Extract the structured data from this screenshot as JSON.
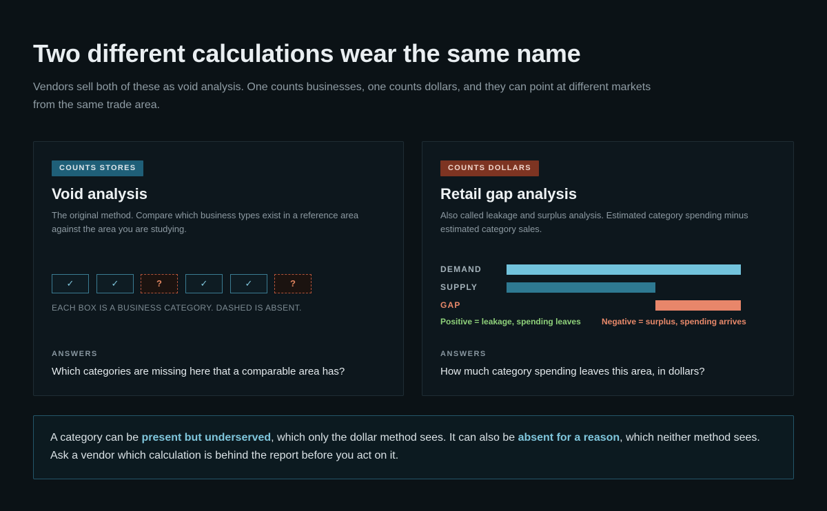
{
  "header": {
    "title": "Two different calculations wear the same name",
    "subtitle": "Vendors sell both of these as void analysis. One counts businesses, one counts dollars, and they can point at different markets from the same trade area."
  },
  "cards": {
    "void": {
      "tag": "COUNTS STORES",
      "title": "Void analysis",
      "description": "The original method. Compare which business types exist in a reference area against the area you are studying.",
      "boxes": [
        {
          "state": "present",
          "glyph": "✓"
        },
        {
          "state": "present",
          "glyph": "✓"
        },
        {
          "state": "absent",
          "glyph": "?"
        },
        {
          "state": "present",
          "glyph": "✓"
        },
        {
          "state": "present",
          "glyph": "✓"
        },
        {
          "state": "absent",
          "glyph": "?"
        }
      ],
      "caption": "EACH BOX IS A BUSINESS CATEGORY. DASHED IS ABSENT.",
      "answers_label": "ANSWERS",
      "answers_text": "Which categories are missing here that a comparable area has?"
    },
    "gap": {
      "tag": "COUNTS DOLLARS",
      "title": "Retail gap analysis",
      "description": "Also called leakage and surplus analysis. Estimated category spending minus estimated category sales.",
      "bars": {
        "demand_label": "DEMAND",
        "supply_label": "SUPPLY",
        "gap_label": "GAP",
        "demand": 1.0,
        "supply": 0.635,
        "gap_start": 0.635,
        "gap_end": 1.0
      },
      "legend": {
        "positive": "Positive = leakage, spending leaves",
        "negative": "Negative = surplus, spending arrives"
      },
      "answers_label": "ANSWERS",
      "answers_text": "How much category spending leaves this area, in dollars?"
    }
  },
  "note": {
    "part1": "A category can be ",
    "hl1": "present but underserved",
    "part2": ", which only the dollar method sees. It can also be ",
    "hl2": "absent for a reason",
    "part3": ", which neither method sees. Ask a vendor which calculation is behind the report before you act on it."
  },
  "colors": {
    "accent_blue": "#72c3dc",
    "accent_rust": "#e8866a",
    "positive_green": "#8ed07a"
  }
}
